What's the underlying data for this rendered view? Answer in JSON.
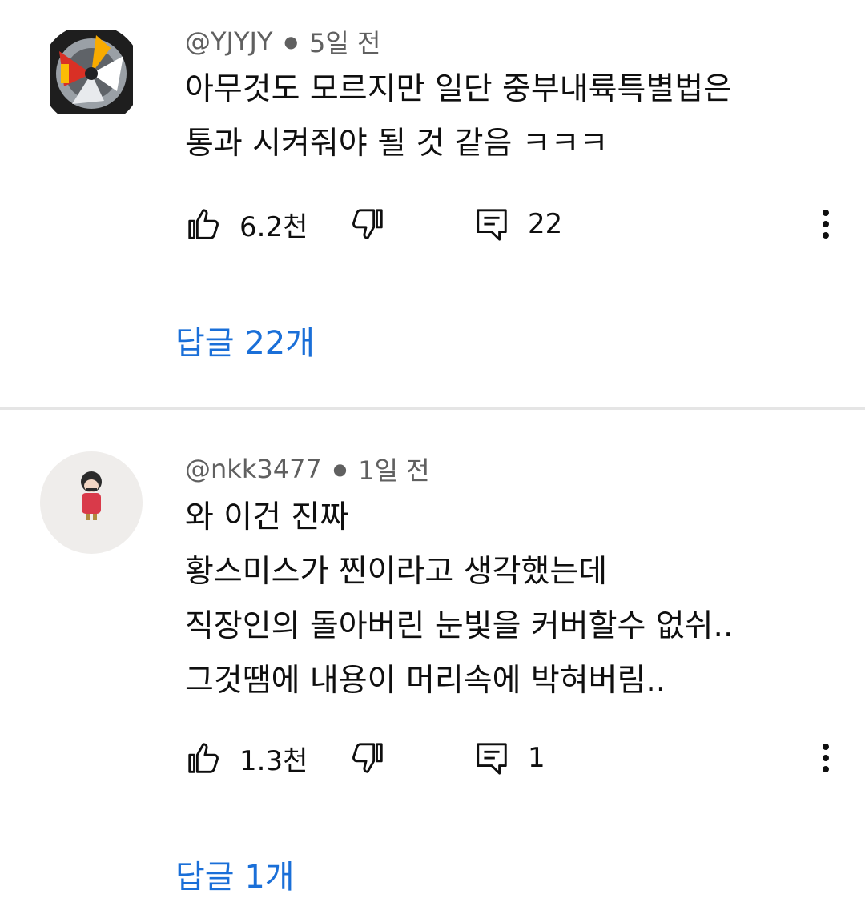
{
  "comments": [
    {
      "handle": "@YJYJY",
      "time": "5일 전",
      "lines": [
        "아무것도 모르지만 일단 중부내륙특별법은",
        "통과 시켜줘야 될 것 같음 ㅋㅋㅋ"
      ],
      "likes": "6.2천",
      "reply_count": "22",
      "replies_label": "답글 22개"
    },
    {
      "handle": "@nkk3477",
      "time": "1일 전",
      "lines": [
        "와 이건 진짜",
        "황스미스가 찐이라고 생각했는데",
        "직장인의 돌아버린 눈빛을 커버할수 없쉬..",
        "그것땜에 내용이 머리속에 박혀버림.."
      ],
      "likes": "1.3천",
      "reply_count": "1",
      "replies_label": "답글 1개"
    }
  ],
  "colors": {
    "accent": "#1a6fd8",
    "meta": "#606060",
    "divider": "#e5e5e5",
    "text": "#0f0f0f"
  },
  "icons": [
    "thumb-up-icon",
    "thumb-down-icon",
    "reply-icon",
    "more-vert-icon"
  ]
}
